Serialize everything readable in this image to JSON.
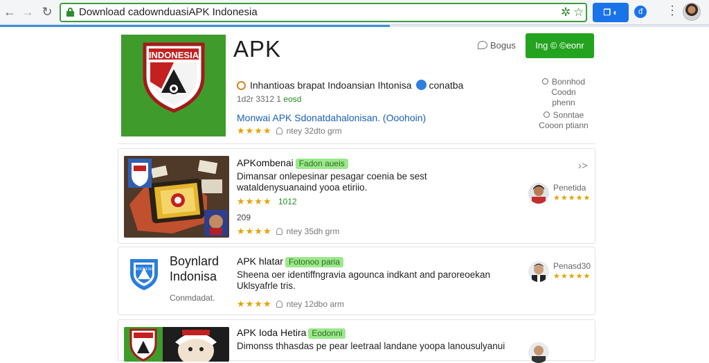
{
  "browser": {
    "url": "Download cadownduasiAPK Indonesia",
    "ext_label": "❐ ◐",
    "ext_icon": "ᵭ",
    "load_progress": 0.55,
    "icons": [
      "back-icon",
      "forward-icon",
      "reload-icon",
      "lock-icon",
      "star-icon",
      "menu-icon",
      "profile-avatar"
    ]
  },
  "header": {
    "logo_text": "INDONESIA",
    "title": "APK",
    "bookmark_label": "Bogus",
    "install_label": "Ing © ©eonr",
    "publisher": "Inhantioas brapat Indoansian Ihtonisa",
    "publisher_suffix": "conatba",
    "version": "1d2r 3312 1",
    "version_tag": "eosd",
    "description_link": "Monwai APK Sdonatdahalonisan. (Ooohoin)",
    "rating_stars": "★★★★",
    "meta_text": "ntey 32dto grm",
    "side_stats": [
      {
        "line1": "Bonnhod",
        "line2": "Coodn phenn"
      },
      {
        "line1": "Sonntae",
        "line2": "Cooon ptiann"
      }
    ]
  },
  "items": [
    {
      "title": "APKombenai",
      "tag": "Fadon aueis",
      "description": "Dimansar onlepesinar pesagar coenia be sest wataldenysuanaind yooa etiriio.",
      "rating": "1012",
      "count": "209",
      "stars": "★★★★",
      "meta_text": "ntey 35dh grm",
      "reviewer": "Penetida",
      "reviewer_stars": "★★★★★",
      "chevron": "›>"
    },
    {
      "title": "APK hlatar",
      "tag": "Fotonoo paria",
      "big_name_line1": "Boynlard",
      "big_name_line2": "Indonisa",
      "sub_name": "Conmdadat.",
      "description": "Sheena oer identiffngravia agounca indkant and paroreoekan Uklsyafrle tris.",
      "stars": "★★★★",
      "meta_text": "ntey 12dbo arm",
      "reviewer": "Penasd30",
      "reviewer_stars": "★★★★★"
    },
    {
      "title": "APK Ioda Hetira",
      "tag": "Eodonni",
      "description": "Dimonss thhasdas pe pear leetraal landane yoopa lanousulyanui",
      "reviewer_stars": ""
    }
  ],
  "colors": {
    "brand_green": "#3f9c2c",
    "install_green": "#23a31f",
    "link_blue": "#1a5fb4",
    "star_gold": "#e8a100",
    "tag_green": "#9be88d"
  }
}
